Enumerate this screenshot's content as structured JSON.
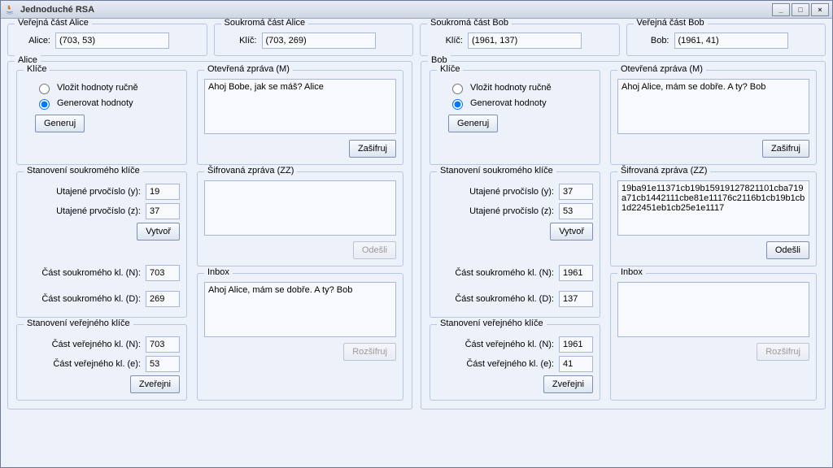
{
  "window": {
    "title": "Jednoduché RSA"
  },
  "top": {
    "alice_public": {
      "legend": "Veřejná část Alice",
      "label": "Alice:",
      "value": "(703, 53)"
    },
    "alice_private": {
      "legend": "Soukromá část Alice",
      "label": "Klíč:",
      "value": "(703, 269)"
    },
    "bob_private": {
      "legend": "Soukromá část Bob",
      "label": "Klíč:",
      "value": "(1961, 137)"
    },
    "bob_public": {
      "legend": "Veřejná část Bob",
      "label": "Bob:",
      "value": "(1961, 41)"
    }
  },
  "labels": {
    "keys": "Klíče",
    "radio_manual": "Vložit hodnoty ručně",
    "radio_generate": "Generovat hodnoty",
    "generate_btn": "Generuj",
    "private_key_panel": "Stanovení soukromého klíče",
    "prime_y": "Utajené prvočíslo (y):",
    "prime_z": "Utajené prvočíslo (z):",
    "create_btn": "Vytvoř",
    "priv_n": "Část soukromého kl. (N):",
    "priv_d": "Část soukromého kl. (D):",
    "public_key_panel": "Stanovení veřejného klíče",
    "pub_n": "Část veřejného kl. (N):",
    "pub_e": "Část veřejného kl. (e):",
    "publish_btn": "Zveřejni",
    "open_msg": "Otevřená zpráva (M)",
    "encrypt_btn": "Zašifruj",
    "cipher_msg": "Šifrovaná zpráva (ZZ)",
    "send_btn": "Odešli",
    "inbox": "Inbox",
    "decrypt_btn": "Rozšifruj"
  },
  "alice": {
    "legend": "Alice",
    "prime_y": "19",
    "prime_z": "37",
    "priv_n": "703",
    "priv_d": "269",
    "pub_n": "703",
    "pub_e": "53",
    "open_msg": "Ahoj Bobe, jak se máš? Alice",
    "cipher": "",
    "inbox": "Ahoj Alice, mám se dobře. A ty? Bob"
  },
  "bob": {
    "legend": "Bob",
    "prime_y": "37",
    "prime_z": "53",
    "priv_n": "1961",
    "priv_d": "137",
    "pub_n": "1961",
    "pub_e": "41",
    "open_msg": "Ahoj Alice, mám se dobře. A ty? Bob",
    "cipher": "19ba91e11371cb19b15919127821101cba719a71cb1442111cbe81e11176c2116b1cb19b1cb1d22451eb1cb25e1e1117",
    "inbox": ""
  }
}
